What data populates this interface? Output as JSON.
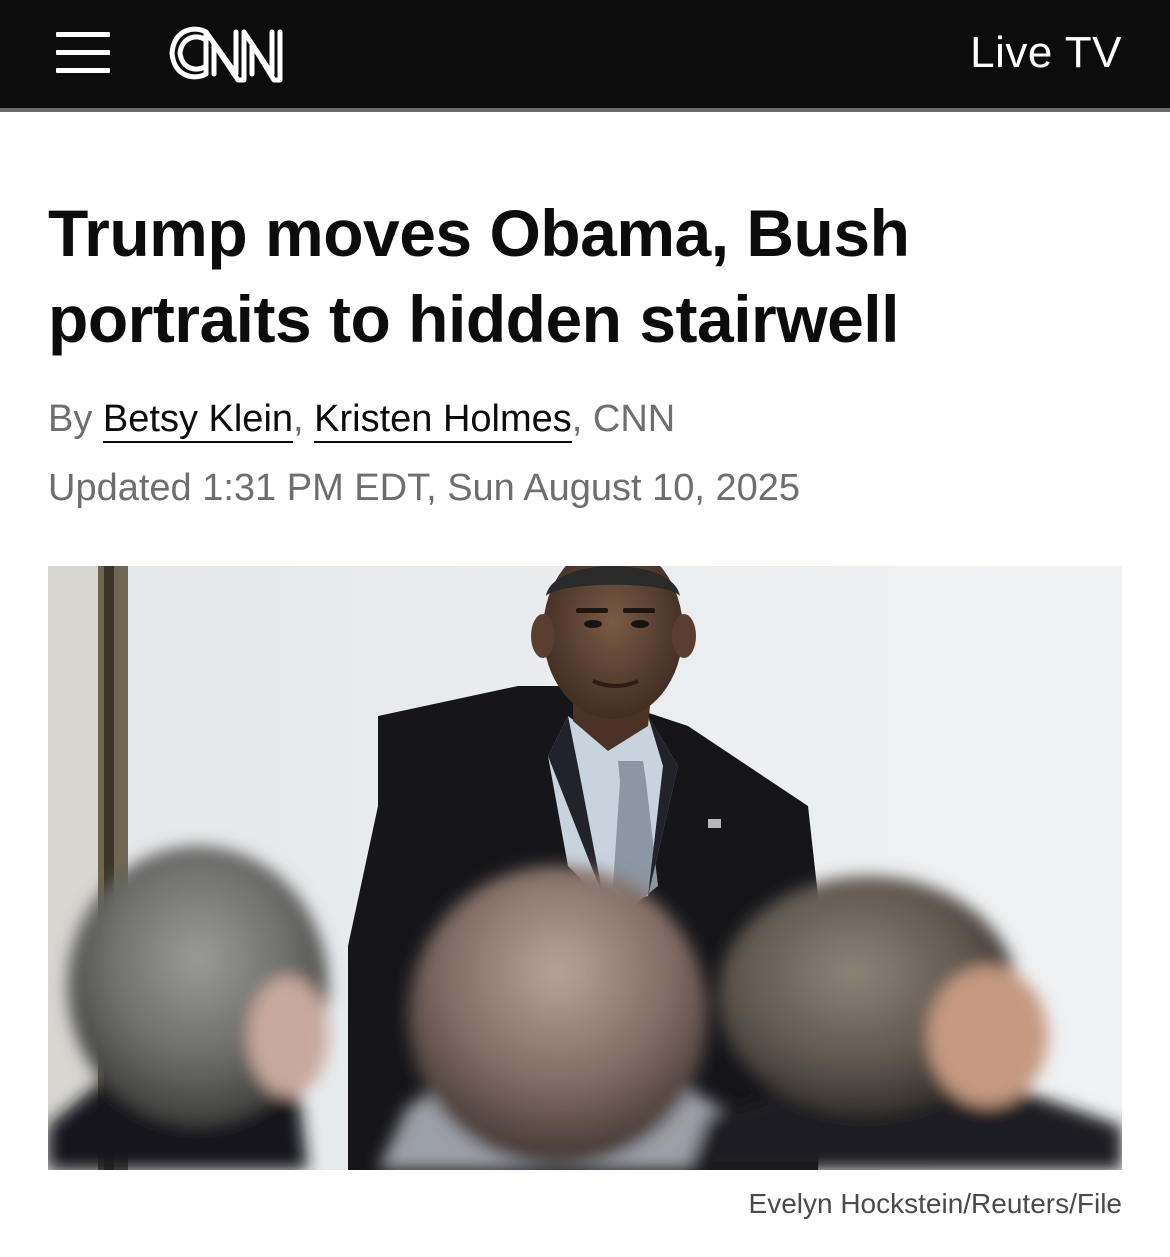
{
  "header": {
    "menu_icon": "hamburger-menu-icon",
    "logo_text": "CNN",
    "live_tv_label": "Live TV",
    "background_color": "#0c0c0c"
  },
  "article": {
    "headline": "Trump moves Obama, Bush portraits to hidden stairwell",
    "byline_prefix": "By",
    "authors": [
      "Betsy Klein",
      "Kristen Holmes"
    ],
    "byline_separator": ",",
    "byline_suffix": ", CNN",
    "updated": "Updated 1:31 PM EDT, Sun August 10, 2025"
  },
  "photo": {
    "subject": "portrait-photo",
    "credit": "Evelyn Hockstein/Reuters/File"
  }
}
